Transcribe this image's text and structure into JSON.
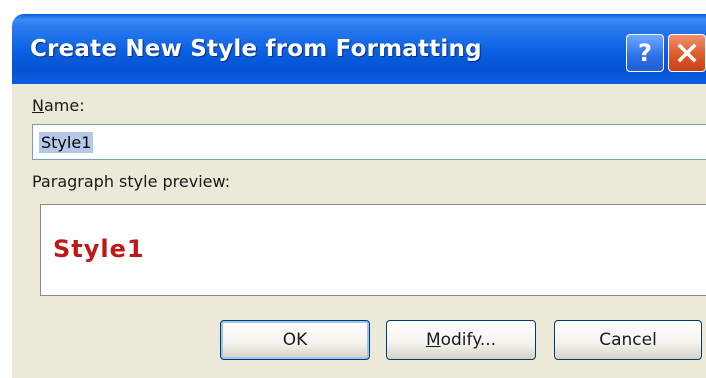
{
  "window": {
    "title": "Create New Style from Formatting",
    "help_button_label": "?",
    "close_button_icon": "close-icon"
  },
  "form": {
    "name_label_prefix": "N",
    "name_label_rest": "ame:",
    "name_value": "Style1",
    "preview_label": "Paragraph style preview:",
    "preview_text": "Style1",
    "preview_color": "#c01818"
  },
  "buttons": {
    "ok_label": "OK",
    "modify_prefix": "M",
    "modify_rest": "odify...",
    "cancel_label": "Cancel"
  },
  "colors": {
    "titlebar_blue": "#0a5fe0",
    "dialog_background": "#ece9d8",
    "close_red": "#e05a2a"
  }
}
